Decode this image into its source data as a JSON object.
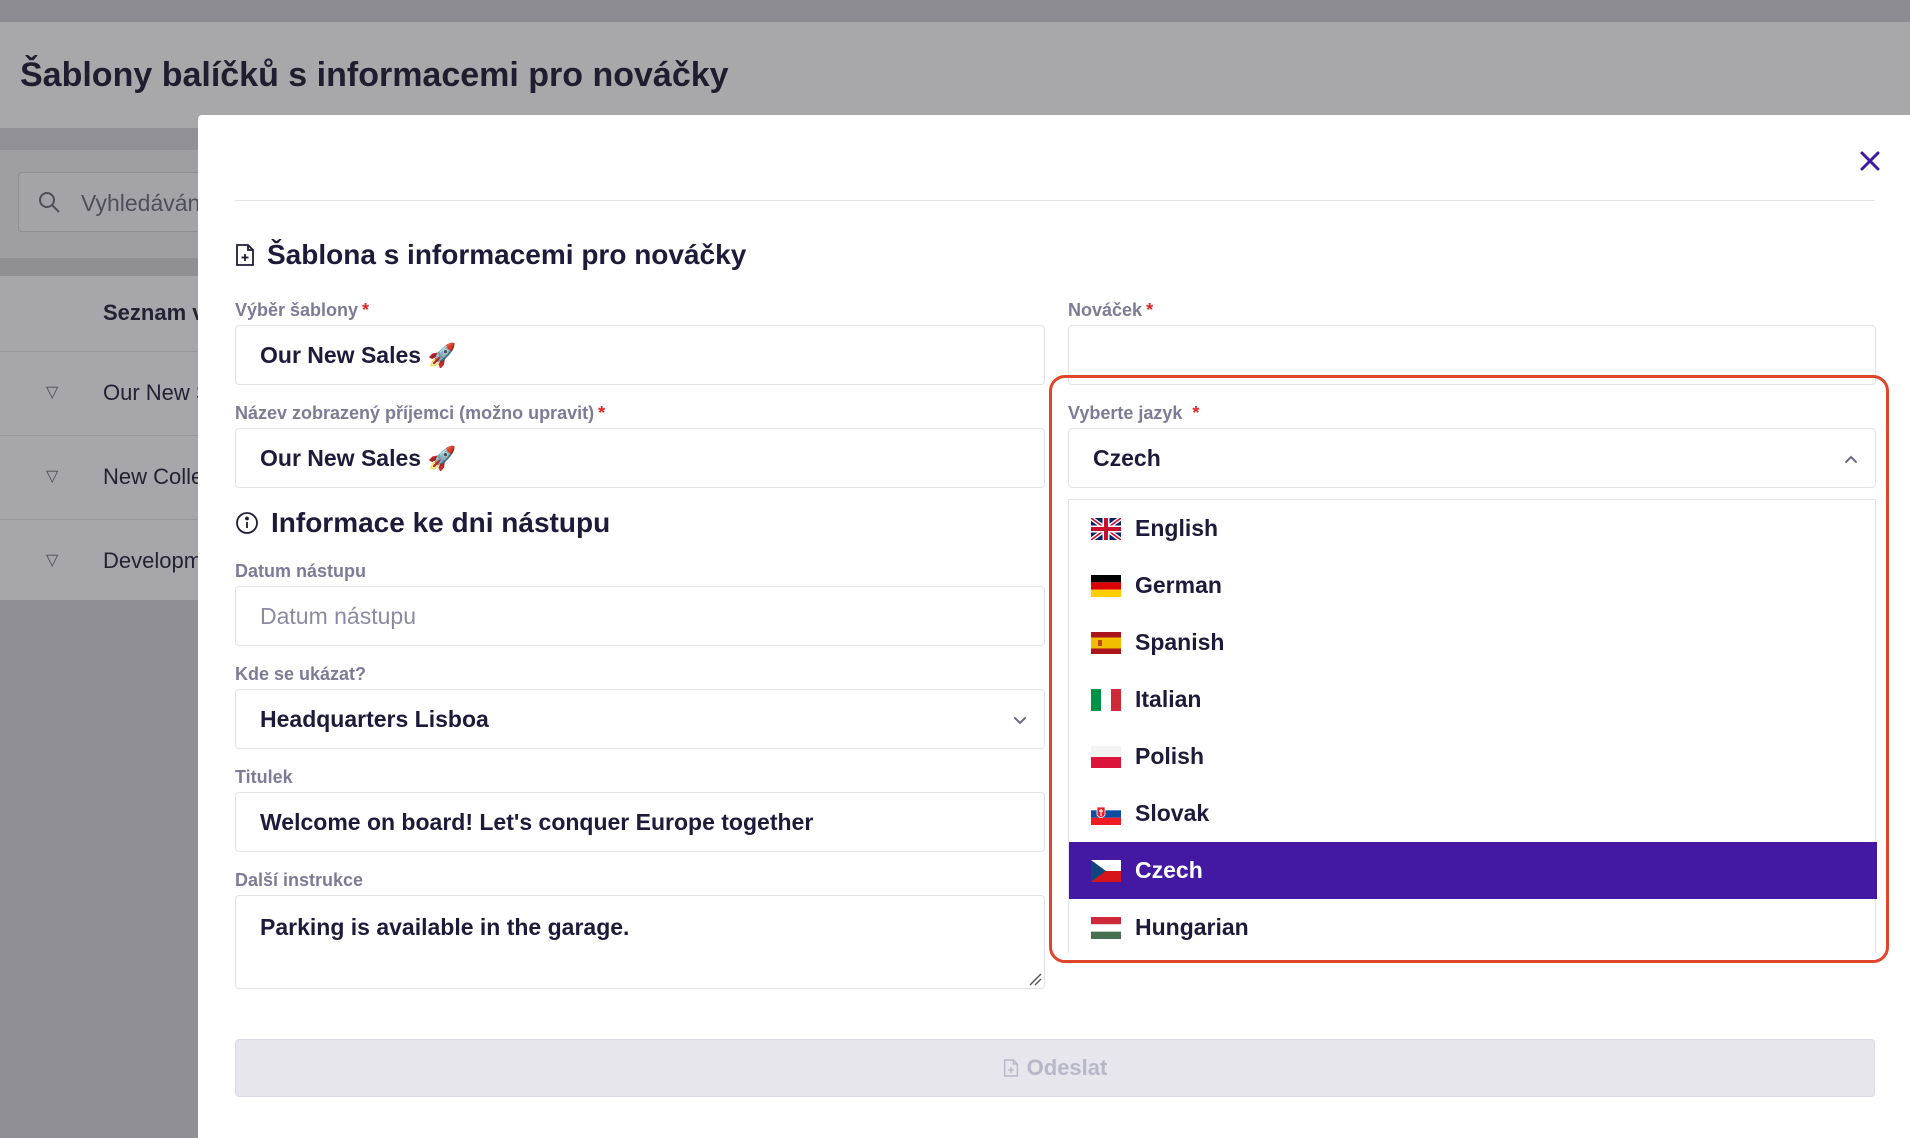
{
  "background": {
    "page_title": "Šablony balíčků s informacemi pro nováčky",
    "search_placeholder": "Vyhledávání",
    "table_header": "Seznam vy",
    "rows": [
      "Our New S",
      "New Colle",
      "Developm"
    ]
  },
  "modal": {
    "section_template_title": "Šablona s informacemi pro nováčky",
    "template_select": {
      "label": "Výběr šablony",
      "value": "Our New Sales 🚀"
    },
    "display_name": {
      "label": "Název zobrazený příjemci (možno upravit)",
      "value": "Our New Sales 🚀"
    },
    "newcomer": {
      "label": "Nováček",
      "value": ""
    },
    "language": {
      "label": "Vyberte jazyk",
      "value": "Czech",
      "options": [
        "English",
        "German",
        "Spanish",
        "Italian",
        "Polish",
        "Slovak",
        "Czech",
        "Hungarian"
      ],
      "selected": "Czech"
    },
    "section_start_title": "Informace ke dni nástupu",
    "start_date": {
      "label": "Datum nástupu",
      "placeholder": "Datum nástupu"
    },
    "location": {
      "label": "Kde se ukázat?",
      "value": "Headquarters Lisboa"
    },
    "headline": {
      "label": "Titulek",
      "value": "Welcome on board! Let's conquer Europe together"
    },
    "instructions": {
      "label": "Další instrukce",
      "value": "Parking is available in the garage."
    },
    "submit_label": "Odeslat",
    "required_mark": "*"
  },
  "colors": {
    "accent": "#4318a3",
    "highlight_border": "#e0442a",
    "required": "#e02424"
  },
  "icons": {
    "close": "close-icon",
    "search": "search-icon",
    "document": "document-icon",
    "info": "info-icon",
    "chevron_up": "chevron-up-icon",
    "chevron_down": "chevron-down-icon"
  }
}
